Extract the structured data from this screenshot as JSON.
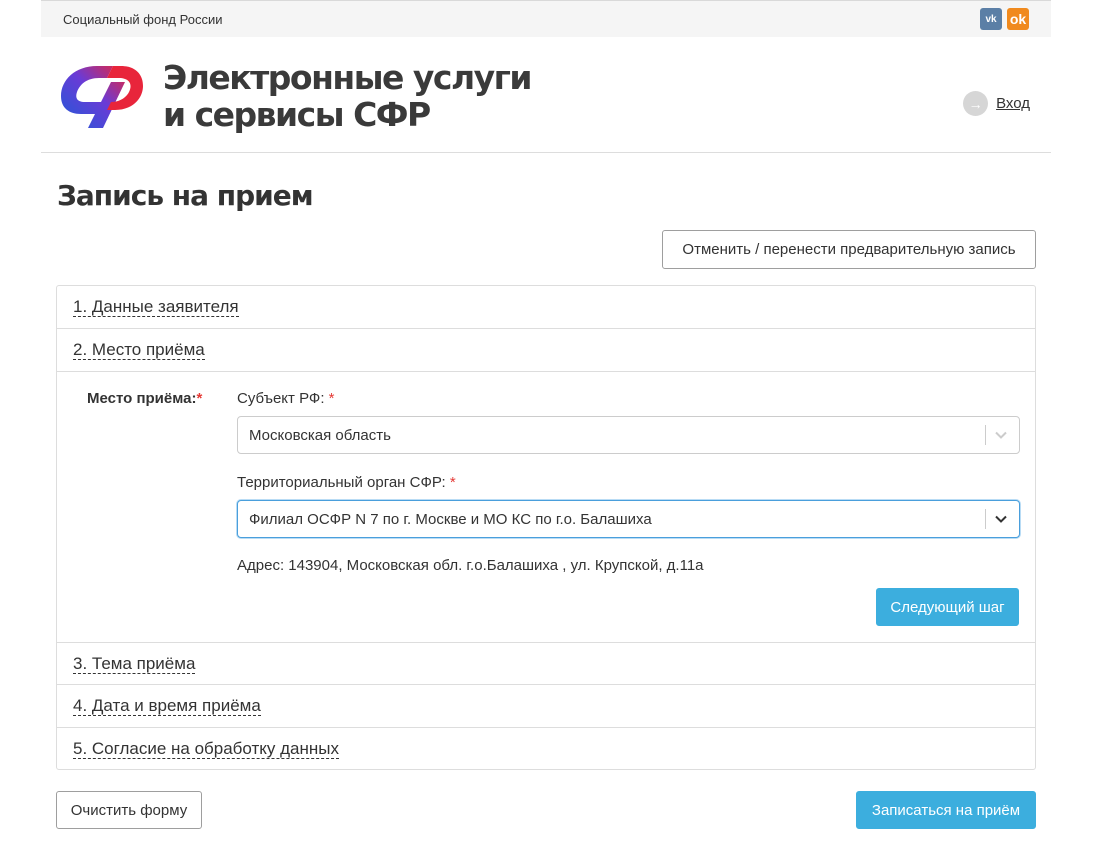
{
  "topbar": {
    "org_name": "Социальный фонд России",
    "social": [
      {
        "name": "vk-icon",
        "glyph": "vk"
      },
      {
        "name": "ok-icon",
        "glyph": "ok"
      }
    ]
  },
  "header": {
    "title_line1": "Электронные услуги",
    "title_line2": "и сервисы СФР",
    "login_label": "Вход",
    "logo_colors": {
      "blue": "#1e5bd8",
      "red": "#e8253b"
    }
  },
  "page": {
    "title": "Запись на прием",
    "cancel_button": "Отменить / перенести предварительную запись"
  },
  "steps": [
    {
      "label": "1. Данные заявителя"
    },
    {
      "label": "2. Место приёма"
    },
    {
      "label": "3. Тема приёма"
    },
    {
      "label": "4. Дата и время приёма"
    },
    {
      "label": "5. Согласие на обработку данных"
    }
  ],
  "place": {
    "main_label": "Место приёма:",
    "required_mark": "*",
    "subject_label": "Субъект РФ:",
    "subject_value": "Московская область",
    "organ_label": "Территориальный орган СФР:",
    "organ_value": "Филиал ОСФР N 7 по г. Москве и МО КС по г.о. Балашиха",
    "address": "Адрес: 143904, Московская обл. г.о.Балашиха , ул. Крупской, д.11а",
    "next_button": "Следующий шаг"
  },
  "footer": {
    "clear_button": "Очистить форму",
    "submit_button": "Записаться на приём"
  },
  "colors": {
    "accent": "#3caede",
    "required": "#e53935",
    "focus": "#4a9fdc"
  }
}
